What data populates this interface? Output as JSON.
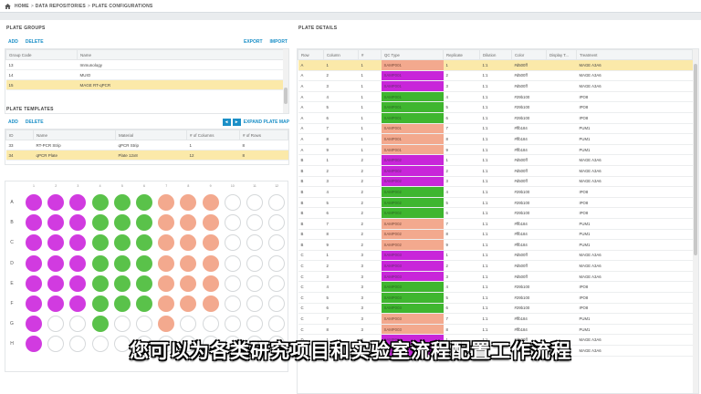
{
  "breadcrumb": {
    "home": "HOME",
    "repos": "DATA REPOSITORIES",
    "current": "PLATE CONFIGURATIONS",
    "sep": ">"
  },
  "plate_groups": {
    "title": "PLATE GROUPS",
    "actions": {
      "add": "ADD",
      "delete": "DELETE",
      "export": "EXPORT",
      "import": "IMPORT"
    },
    "columns": [
      "Group Code",
      "Name"
    ],
    "rows": [
      {
        "code": "13",
        "name": "Immunology"
      },
      {
        "code": "14",
        "name": "MUIO"
      },
      {
        "code": "15",
        "name": "MAGE RT-qPCR"
      }
    ],
    "selected_index": 2
  },
  "plate_templates": {
    "title": "PLATE TEMPLATES",
    "actions": {
      "add": "ADD",
      "delete": "DELETE",
      "expand": "EXPAND PLATE MAP",
      "prev": "◂",
      "next": "▸"
    },
    "columns": [
      "ID",
      "Name",
      "Material",
      "# of Columns",
      "# of Rows"
    ],
    "rows": [
      {
        "id": "33",
        "name": "RT-PCR Strip",
        "material": "qPCR Strip",
        "cols": "1",
        "rows": "8"
      },
      {
        "id": "34",
        "name": "qPCR Plate",
        "material": "Plate 12x8",
        "cols": "12",
        "rows": "8"
      }
    ],
    "selected_index": 1
  },
  "plate_map": {
    "row_labels": [
      "A",
      "B",
      "C",
      "D",
      "E",
      "F",
      "G",
      "H"
    ],
    "col_labels": [
      "1",
      "2",
      "3",
      "4",
      "5",
      "6",
      "7",
      "8",
      "9",
      "10",
      "11",
      "12"
    ],
    "colors": {
      "M": "#d13be0",
      "G": "#5ac24a",
      "S": "#f3a98e",
      "E": "#ffffff"
    },
    "wells": [
      "MMMGGGSSSEEE",
      "MMMGGGSSSEEE",
      "MMMGGGSSSEEE",
      "MMMGGGSSSEEE",
      "MMMGGGSSSEEE",
      "MMMGGGSSSEEE",
      "MEEGEESEEEEE",
      "MEEEEEEEEEEE"
    ]
  },
  "plate_details": {
    "title": "PLATE DETAILS",
    "columns": [
      "Row",
      "Column",
      "#",
      "QC Type",
      "Replicate",
      "Dilution",
      "Color",
      "Display T...",
      "Treatment"
    ],
    "qc_colors": {
      "M": "#c826d9",
      "G": "#3fb62f",
      "S": "#f3a98e"
    },
    "rows": [
      {
        "row": "A",
        "col": "1",
        "num": "1",
        "qc": "SAMP001",
        "qcc": "S",
        "rep": "1",
        "dil": "1:1",
        "color": "#d500ff",
        "disp": "",
        "treat": "MAGE A3A6"
      },
      {
        "row": "A",
        "col": "2",
        "num": "1",
        "qc": "SAMP001",
        "qcc": "M",
        "rep": "2",
        "dil": "1:1",
        "color": "#d500ff",
        "disp": "",
        "treat": "MAGE A3A6"
      },
      {
        "row": "A",
        "col": "3",
        "num": "1",
        "qc": "SAMP001",
        "qcc": "M",
        "rep": "3",
        "dil": "1:1",
        "color": "#d500ff",
        "disp": "",
        "treat": "MAGE A3A6"
      },
      {
        "row": "A",
        "col": "4",
        "num": "1",
        "qc": "SAMP001",
        "qcc": "G",
        "rep": "4",
        "dil": "1:1",
        "color": "#29b100",
        "disp": "",
        "treat": "IPO8"
      },
      {
        "row": "A",
        "col": "5",
        "num": "1",
        "qc": "SAMP001",
        "qcc": "G",
        "rep": "5",
        "dil": "1:1",
        "color": "#29b100",
        "disp": "",
        "treat": "IPO8"
      },
      {
        "row": "A",
        "col": "6",
        "num": "1",
        "qc": "SAMP001",
        "qcc": "G",
        "rep": "6",
        "dil": "1:1",
        "color": "#29b100",
        "disp": "",
        "treat": "IPO8"
      },
      {
        "row": "A",
        "col": "7",
        "num": "1",
        "qc": "SAMP001",
        "qcc": "S",
        "rep": "7",
        "dil": "1:1",
        "color": "#ffb184",
        "disp": "",
        "treat": "PUM1"
      },
      {
        "row": "A",
        "col": "8",
        "num": "1",
        "qc": "SAMP001",
        "qcc": "S",
        "rep": "8",
        "dil": "1:1",
        "color": "#ffb184",
        "disp": "",
        "treat": "PUM1"
      },
      {
        "row": "A",
        "col": "9",
        "num": "1",
        "qc": "SAMP001",
        "qcc": "S",
        "rep": "9",
        "dil": "1:1",
        "color": "#ffb184",
        "disp": "",
        "treat": "PUM1"
      },
      {
        "row": "B",
        "col": "1",
        "num": "2",
        "qc": "SAMP002",
        "qcc": "M",
        "rep": "1",
        "dil": "1:1",
        "color": "#d500ff",
        "disp": "",
        "treat": "MAGE A3A6"
      },
      {
        "row": "B",
        "col": "2",
        "num": "2",
        "qc": "SAMP002",
        "qcc": "M",
        "rep": "2",
        "dil": "1:1",
        "color": "#d500ff",
        "disp": "",
        "treat": "MAGE A3A6"
      },
      {
        "row": "B",
        "col": "3",
        "num": "2",
        "qc": "SAMP002",
        "qcc": "M",
        "rep": "3",
        "dil": "1:1",
        "color": "#d500ff",
        "disp": "",
        "treat": "MAGE A3A6"
      },
      {
        "row": "B",
        "col": "4",
        "num": "2",
        "qc": "SAMP002",
        "qcc": "G",
        "rep": "4",
        "dil": "1:1",
        "color": "#29b100",
        "disp": "",
        "treat": "IPO8"
      },
      {
        "row": "B",
        "col": "5",
        "num": "2",
        "qc": "SAMP002",
        "qcc": "G",
        "rep": "5",
        "dil": "1:1",
        "color": "#29b100",
        "disp": "",
        "treat": "IPO8"
      },
      {
        "row": "B",
        "col": "6",
        "num": "2",
        "qc": "SAMP002",
        "qcc": "G",
        "rep": "6",
        "dil": "1:1",
        "color": "#29b100",
        "disp": "",
        "treat": "IPO8"
      },
      {
        "row": "B",
        "col": "7",
        "num": "2",
        "qc": "SAMP002",
        "qcc": "S",
        "rep": "7",
        "dil": "1:1",
        "color": "#ffb184",
        "disp": "",
        "treat": "PUM1"
      },
      {
        "row": "B",
        "col": "8",
        "num": "2",
        "qc": "SAMP002",
        "qcc": "S",
        "rep": "8",
        "dil": "1:1",
        "color": "#ffb184",
        "disp": "",
        "treat": "PUM1"
      },
      {
        "row": "B",
        "col": "9",
        "num": "2",
        "qc": "SAMP002",
        "qcc": "S",
        "rep": "9",
        "dil": "1:1",
        "color": "#ffb184",
        "disp": "",
        "treat": "PUM1"
      },
      {
        "row": "C",
        "col": "1",
        "num": "3",
        "qc": "SAMP003",
        "qcc": "M",
        "rep": "1",
        "dil": "1:1",
        "color": "#d500ff",
        "disp": "",
        "treat": "MAGE A3A6"
      },
      {
        "row": "C",
        "col": "2",
        "num": "3",
        "qc": "SAMP003",
        "qcc": "M",
        "rep": "2",
        "dil": "1:1",
        "color": "#d500ff",
        "disp": "",
        "treat": "MAGE A3A6"
      },
      {
        "row": "C",
        "col": "3",
        "num": "3",
        "qc": "SAMP003",
        "qcc": "M",
        "rep": "3",
        "dil": "1:1",
        "color": "#d500ff",
        "disp": "",
        "treat": "MAGE A3A6"
      },
      {
        "row": "C",
        "col": "4",
        "num": "3",
        "qc": "SAMP003",
        "qcc": "G",
        "rep": "4",
        "dil": "1:1",
        "color": "#29b100",
        "disp": "",
        "treat": "IPO8"
      },
      {
        "row": "C",
        "col": "5",
        "num": "3",
        "qc": "SAMP003",
        "qcc": "G",
        "rep": "5",
        "dil": "1:1",
        "color": "#29b100",
        "disp": "",
        "treat": "IPO8"
      },
      {
        "row": "C",
        "col": "6",
        "num": "3",
        "qc": "SAMP003",
        "qcc": "G",
        "rep": "6",
        "dil": "1:1",
        "color": "#29b100",
        "disp": "",
        "treat": "IPO8"
      },
      {
        "row": "C",
        "col": "7",
        "num": "3",
        "qc": "SAMP003",
        "qcc": "S",
        "rep": "7",
        "dil": "1:1",
        "color": "#ffb184",
        "disp": "",
        "treat": "PUM1"
      },
      {
        "row": "C",
        "col": "8",
        "num": "3",
        "qc": "SAMP003",
        "qcc": "S",
        "rep": "8",
        "dil": "1:1",
        "color": "#ffb184",
        "disp": "",
        "treat": "PUM1"
      },
      {
        "row": "D",
        "col": "1",
        "num": "4",
        "qc": "SAMP004",
        "qcc": "M",
        "rep": "1",
        "dil": "1:1",
        "color": "#d500ff",
        "disp": "",
        "treat": "MAGE A3A6"
      },
      {
        "row": "D",
        "col": "2",
        "num": "4",
        "qc": "SAMP004",
        "qcc": "M",
        "rep": "2",
        "dil": "1:1",
        "color": "#d500ff",
        "disp": "",
        "treat": "MAGE A3A6"
      }
    ]
  },
  "subtitle": "您可以为各类研究项目和实验室流程配置工作流程"
}
